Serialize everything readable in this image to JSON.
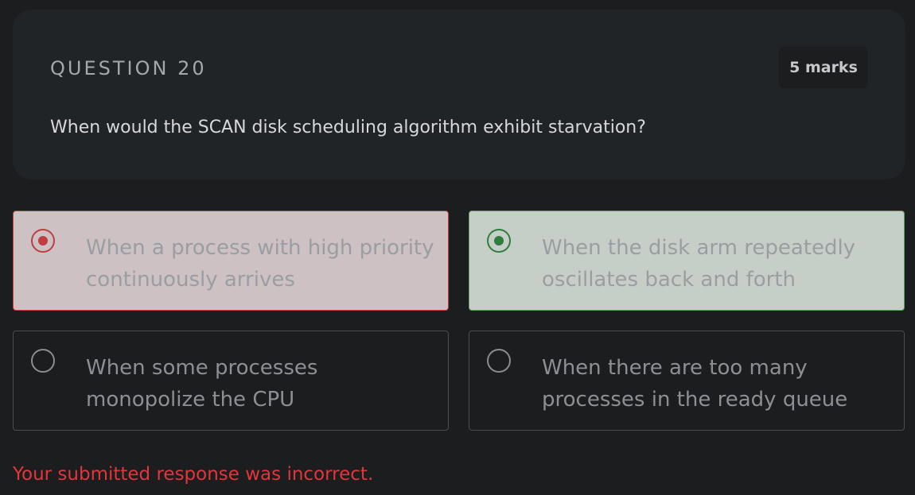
{
  "question": {
    "number_label": "QUESTION 20",
    "marks": "5 marks",
    "text": "When would the SCAN disk scheduling algorithm exhibit starvation?"
  },
  "options": [
    {
      "line1": "When a process with high priority",
      "line2": "continuously arrives",
      "state": "selected-incorrect"
    },
    {
      "line1": "When the disk arm repeatedly",
      "line2": "oscillates back and forth",
      "state": "correct"
    },
    {
      "line1": "When some processes",
      "line2": "monopolize the CPU",
      "state": "unselected"
    },
    {
      "line1": "When there are too many",
      "line2": "processes in the ready queue",
      "state": "unselected"
    }
  ],
  "feedback": "Your submitted response was incorrect.",
  "colors": {
    "incorrect": "#c23d3f",
    "correct": "#2f7d3c",
    "feedback_text": "#e2363a"
  }
}
